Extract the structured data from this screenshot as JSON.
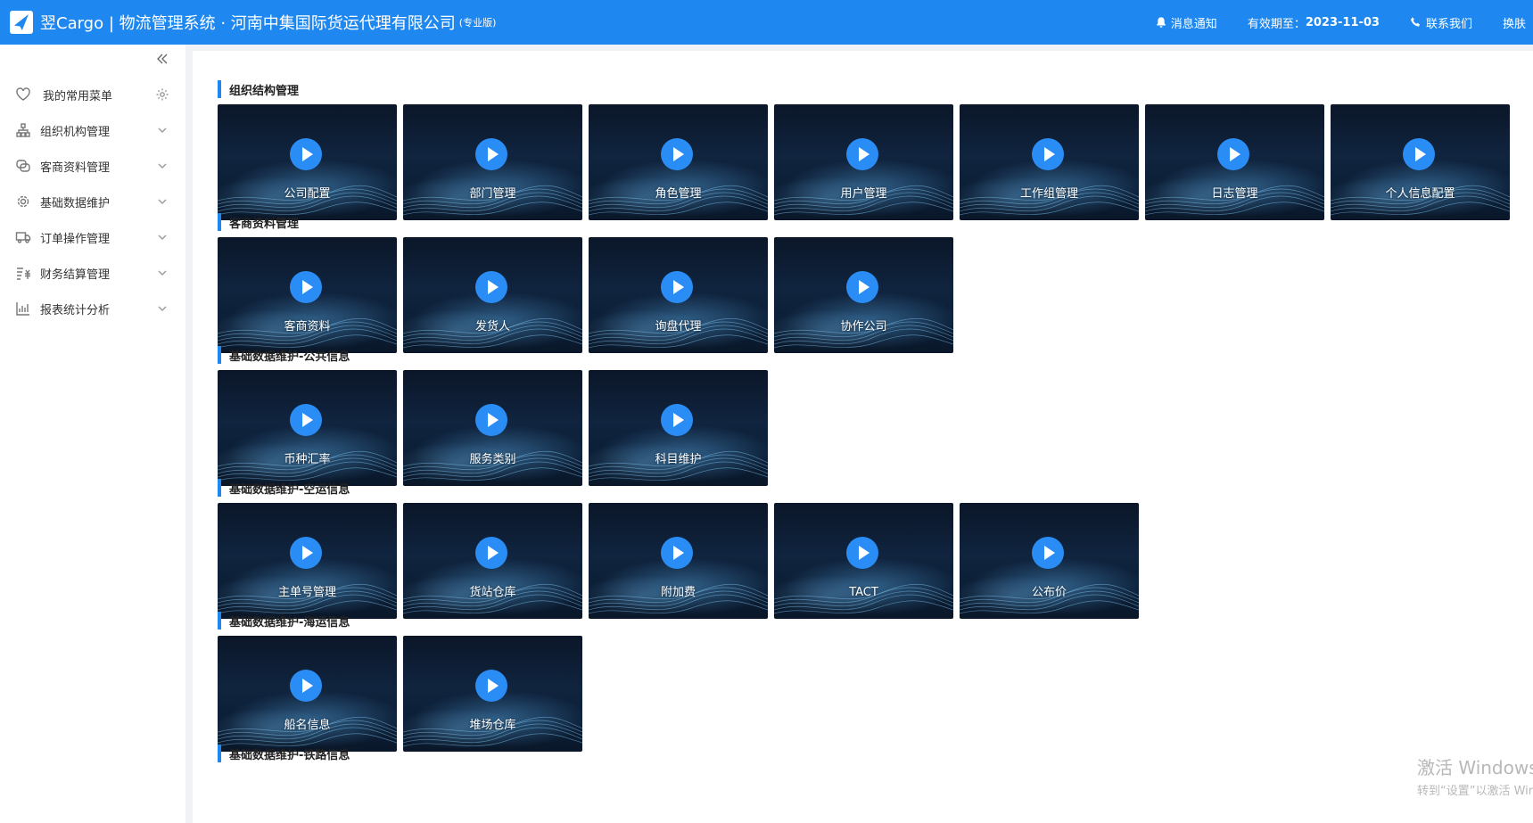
{
  "header": {
    "title": "翌Cargo | 物流管理系统 · 河南中集国际货运代理有限公司",
    "edition": "(专业版)",
    "notify_label": "消息通知",
    "expiry_label": "有效期至：",
    "expiry_date": "2023-11-03",
    "contact_label": "联系我们",
    "skin_label": "换肤"
  },
  "sidebar": {
    "items": [
      {
        "label": "我的常用菜单",
        "icon": "heart-icon"
      },
      {
        "label": "组织机构管理",
        "icon": "org-icon"
      },
      {
        "label": "客商资料管理",
        "icon": "chat-icon"
      },
      {
        "label": "基础数据维护",
        "icon": "gear-icon"
      },
      {
        "label": "订单操作管理",
        "icon": "truck-icon"
      },
      {
        "label": "财务结算管理",
        "icon": "finance-icon"
      },
      {
        "label": "报表统计分析",
        "icon": "chart-icon"
      }
    ]
  },
  "sections": [
    {
      "title": "组织结构管理",
      "cards": [
        "公司配置",
        "部门管理",
        "角色管理",
        "用户管理",
        "工作组管理",
        "日志管理",
        "个人信息配置"
      ]
    },
    {
      "title": "客商资料管理",
      "cards": [
        "客商资料",
        "发货人",
        "询盘代理",
        "协作公司"
      ]
    },
    {
      "title": "基础数据维护-公共信息",
      "cards": [
        "币种汇率",
        "服务类别",
        "科目维护"
      ]
    },
    {
      "title": "基础数据维护-空运信息",
      "cards": [
        "主单号管理",
        "货站仓库",
        "附加费",
        "TACT",
        "公布价"
      ]
    },
    {
      "title": "基础数据维护-海运信息",
      "cards": [
        "船名信息",
        "堆场仓库"
      ]
    },
    {
      "title": "基础数据维护-铁路信息",
      "cards": []
    }
  ],
  "watermark": {
    "line1": "激活 Windows",
    "line2": "转到“设置”以激活 Windows。"
  },
  "colors": {
    "header": "#1e88f0",
    "accent": "#1e88f0"
  }
}
